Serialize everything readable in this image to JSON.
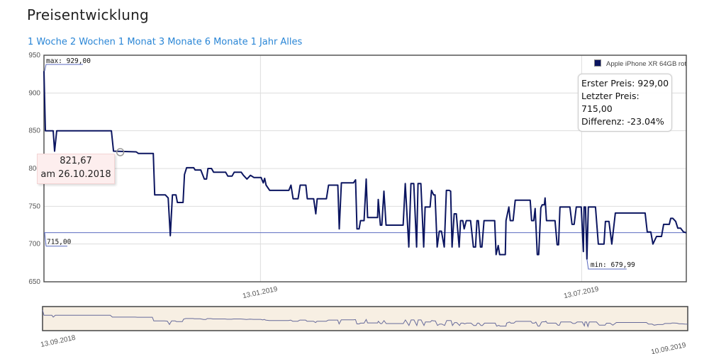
{
  "header": {
    "title": "Preisentwicklung"
  },
  "ranges": [
    "1 Woche",
    "2 Wochen",
    "1 Monat",
    "3 Monate",
    "6 Monate",
    "1 Jahr",
    "Alles"
  ],
  "stats": {
    "first": "Erster Preis: 929,00",
    "last": "Letzter Preis: 715,00",
    "diff": "Differenz: -23.04%"
  },
  "tooltip": {
    "value": "821,67",
    "date": "am 26.10.2018"
  },
  "colors": {
    "line": "#0b1560",
    "ref": "#5b6bc0",
    "nav_bg": "#f7efe3",
    "link": "#2a86d6"
  },
  "chart_data": {
    "type": "line",
    "title": "Preisentwicklung",
    "legend": {
      "label": "Apple iPhone XR 64GB rot",
      "placement": "top-right"
    },
    "ylim": [
      650,
      950
    ],
    "yticks": [
      "650",
      "700",
      "750",
      "800",
      "850",
      "900",
      "950"
    ],
    "xlim_days": [
      0,
      362
    ],
    "xticks": [
      {
        "day": 122,
        "label": "13.01.2019"
      },
      {
        "day": 303,
        "label": "13.07.2019"
      }
    ],
    "navigator_labels": {
      "start": "13.09.2018",
      "end": "10.09.2019"
    },
    "max_label": "max: 929,00",
    "min_label": "min: 679,99",
    "last_label": "715,00",
    "last_price": 715,
    "hover": {
      "day": 43,
      "price": 821.67
    },
    "series": [
      {
        "name": "Apple iPhone XR 64GB rot",
        "points": [
          [
            0,
            929
          ],
          [
            0.8,
            850
          ],
          [
            5.2,
            850
          ],
          [
            6,
            823
          ],
          [
            7.2,
            850
          ],
          [
            38,
            850
          ],
          [
            39.2,
            823
          ],
          [
            52,
            822
          ],
          [
            53.2,
            820
          ],
          [
            61.6,
            820
          ],
          [
            62.4,
            765
          ],
          [
            68.4,
            765
          ],
          [
            70,
            761
          ],
          [
            71.2,
            711
          ],
          [
            72.4,
            765
          ],
          [
            74.4,
            765
          ],
          [
            75.2,
            755
          ],
          [
            78.4,
            755
          ],
          [
            79.2,
            792
          ],
          [
            80.4,
            801
          ],
          [
            84.4,
            801
          ],
          [
            85.2,
            798
          ],
          [
            88.4,
            798
          ],
          [
            90.4,
            786
          ],
          [
            91.6,
            786
          ],
          [
            92.4,
            800
          ],
          [
            94.4,
            800
          ],
          [
            95.6,
            795
          ],
          [
            102.4,
            795
          ],
          [
            103.6,
            790
          ],
          [
            106,
            790
          ],
          [
            107.2,
            795
          ],
          [
            111.2,
            795
          ],
          [
            112.4,
            791
          ],
          [
            114.4,
            786
          ],
          [
            116,
            790
          ],
          [
            116.4,
            791
          ],
          [
            118.4,
            788
          ],
          [
            122.4,
            788
          ],
          [
            123.6,
            781
          ],
          [
            124.4,
            787
          ],
          [
            125.2,
            778
          ],
          [
            127.2,
            771
          ],
          [
            138,
            771
          ],
          [
            139.2,
            778
          ],
          [
            140.4,
            760
          ],
          [
            143.2,
            760
          ],
          [
            144.4,
            778
          ],
          [
            147.6,
            778
          ],
          [
            148.4,
            760
          ],
          [
            152,
            760
          ],
          [
            153.2,
            740
          ],
          [
            154,
            760
          ],
          [
            159.2,
            760
          ],
          [
            160.4,
            778
          ],
          [
            165.6,
            778
          ],
          [
            166.4,
            720
          ],
          [
            167.6,
            781
          ],
          [
            174.4,
            781
          ],
          [
            175.6,
            785
          ],
          [
            176.4,
            720
          ],
          [
            177.6,
            720
          ],
          [
            178.4,
            731
          ],
          [
            180.4,
            731
          ],
          [
            181.6,
            786
          ],
          [
            182.4,
            735
          ],
          [
            188,
            735
          ],
          [
            188.4,
            759
          ],
          [
            189.6,
            725
          ],
          [
            190.4,
            725
          ],
          [
            191.6,
            770
          ],
          [
            192.8,
            725
          ],
          [
            202.4,
            725
          ],
          [
            203.6,
            780
          ],
          [
            205.6,
            696
          ],
          [
            206.8,
            780
          ],
          [
            208.4,
            780
          ],
          [
            210,
            696
          ],
          [
            210.8,
            780
          ],
          [
            212.4,
            780
          ],
          [
            214,
            696
          ],
          [
            214.8,
            749
          ],
          [
            217.6,
            749
          ],
          [
            218.4,
            771
          ],
          [
            219.6,
            765
          ],
          [
            220.4,
            765
          ],
          [
            221.6,
            696
          ],
          [
            222.8,
            717
          ],
          [
            224,
            717
          ],
          [
            225.6,
            696
          ],
          [
            226.8,
            771
          ],
          [
            228.4,
            771
          ],
          [
            229.2,
            770
          ],
          [
            230,
            696
          ],
          [
            231.2,
            740
          ],
          [
            232.4,
            740
          ],
          [
            234,
            696
          ],
          [
            234.8,
            731
          ],
          [
            236,
            731
          ],
          [
            236.8,
            720
          ],
          [
            238,
            731
          ],
          [
            240.4,
            731
          ],
          [
            242,
            696
          ],
          [
            243.2,
            696
          ],
          [
            244,
            731
          ],
          [
            244.8,
            731
          ],
          [
            246,
            696
          ],
          [
            246.8,
            696
          ],
          [
            248,
            731
          ],
          [
            251.2,
            731
          ],
          [
            254,
            731
          ],
          [
            254.8,
            686
          ],
          [
            256,
            698
          ],
          [
            256.8,
            686
          ],
          [
            260,
            686
          ],
          [
            260.4,
            731
          ],
          [
            262,
            749
          ],
          [
            262.8,
            731
          ],
          [
            264.4,
            731
          ],
          [
            265.6,
            758
          ],
          [
            274,
            758
          ],
          [
            274.8,
            731
          ],
          [
            276,
            731
          ],
          [
            276.8,
            747
          ],
          [
            278,
            686
          ],
          [
            278.8,
            686
          ],
          [
            280,
            748
          ],
          [
            280.8,
            752
          ],
          [
            282,
            752
          ],
          [
            282.4,
            761
          ],
          [
            283.2,
            731
          ],
          [
            288,
            731
          ],
          [
            289.2,
            699
          ],
          [
            290,
            699
          ],
          [
            290.8,
            749
          ],
          [
            296.4,
            749
          ],
          [
            297.6,
            726
          ],
          [
            298.8,
            726
          ],
          [
            300,
            749
          ],
          [
            302.8,
            749
          ],
          [
            304,
            690
          ],
          [
            304.4,
            749
          ],
          [
            305.2,
            749
          ],
          [
            306,
            680
          ],
          [
            306.8,
            749
          ],
          [
            310.8,
            749
          ],
          [
            312.4,
            700
          ],
          [
            315.6,
            700
          ],
          [
            316.4,
            730
          ],
          [
            318.4,
            730
          ],
          [
            320,
            700
          ],
          [
            322,
            741
          ],
          [
            338.8,
            741
          ],
          [
            340,
            716
          ],
          [
            342,
            716
          ],
          [
            343.2,
            700
          ],
          [
            345.2,
            710
          ],
          [
            348,
            710
          ],
          [
            349.2,
            726
          ],
          [
            352.4,
            726
          ],
          [
            353.2,
            734
          ],
          [
            354.4,
            734
          ],
          [
            356,
            730
          ],
          [
            357.2,
            721
          ],
          [
            358.8,
            721
          ],
          [
            360.4,
            716
          ],
          [
            362,
            715
          ]
        ]
      }
    ]
  }
}
